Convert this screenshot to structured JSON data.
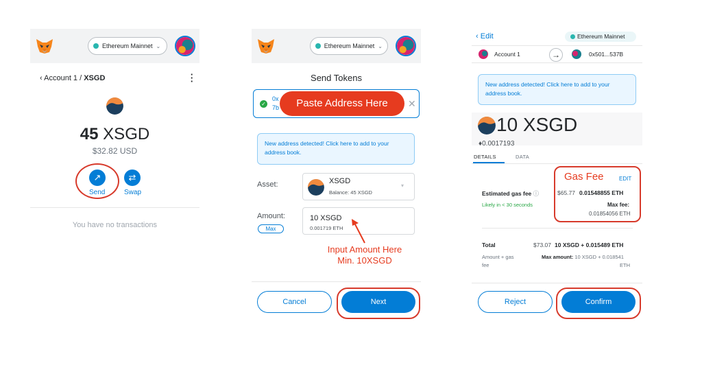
{
  "colors": {
    "accent": "#037dd6",
    "annotation_red": "#e63b1f",
    "success_green": "#28a745"
  },
  "icons": [
    "metamask-fox-icon",
    "network-dot-icon",
    "chevron-down-icon",
    "account-avatar-icon",
    "back-chevron-icon",
    "kebab-menu-icon",
    "xsgd-token-icon",
    "send-arrow-icon",
    "swap-icon",
    "check-circle-icon",
    "close-icon",
    "right-arrow-icon"
  ],
  "screen1": {
    "network": "Ethereum Mainnet",
    "back_account": "Account 1 / ",
    "back_token": "XSGD",
    "balance_num": "45",
    "balance_sym": "XSGD",
    "usd": "$32.82 USD",
    "send_label": "Send",
    "swap_label": "Swap",
    "no_tx": "You have no transactions"
  },
  "screen2": {
    "network": "Ethereum Mainnet",
    "title": "Send Tokens",
    "addr_frag_top": "0x",
    "addr_frag_bottom": "7b",
    "paste_callout": "Paste Address Here",
    "info": "New address detected! Click here to add to your address book.",
    "asset_label": "Asset:",
    "asset_name": "XSGD",
    "asset_balance": "Balance: 45 XSGD",
    "amount_label": "Amount:",
    "max_label": "Max",
    "amount_value": "10  XSGD",
    "amount_eth": "0.001719 ETH",
    "annot_line1": "Input Amount Here",
    "annot_line2": "Min. 10XSGD",
    "cancel": "Cancel",
    "next": "Next"
  },
  "screen3": {
    "edit": "Edit",
    "network": "Ethereum Mainnet",
    "from_account": "Account 1",
    "to_address": "0x501...537B",
    "info": "New address detected! Click here to add to your address book.",
    "amount": "10 XSGD",
    "eth_amount": "0.0017193",
    "tab_details": "DETAILS",
    "tab_data": "DATA",
    "gas_fee_annot": "Gas Fee",
    "gas_edit": "EDIT",
    "est_gas_label": "Estimated gas fee",
    "gas_usd": "$65.77",
    "gas_eth": "0.01548855 ETH",
    "likely": "Likely in < 30 seconds",
    "max_fee_label": "Max fee:",
    "max_fee_value": "0.01854056 ETH",
    "total_label": "Total",
    "total_usd": "$73.07",
    "total_value": "10 XSGD + 0.015489 ETH",
    "amount_gas_line1": "Amount + gas",
    "amount_gas_line2": "fee",
    "max_amount_label": "Max amount:",
    "max_amount_value": " 10 XSGD + 0.018541",
    "max_amount_unit": "ETH",
    "reject": "Reject",
    "confirm": "Confirm"
  }
}
